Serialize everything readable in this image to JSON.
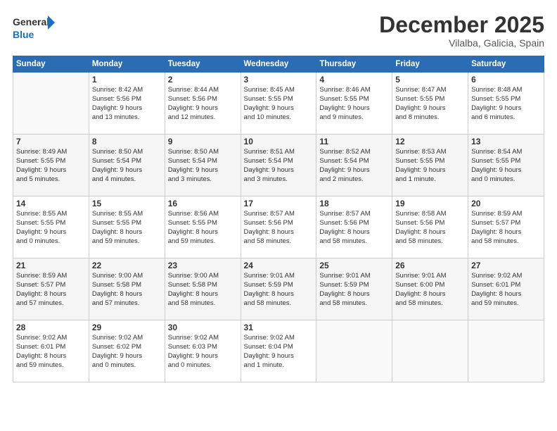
{
  "header": {
    "logo_line1": "General",
    "logo_line2": "Blue",
    "month": "December 2025",
    "location": "Vilalba, Galicia, Spain"
  },
  "weekdays": [
    "Sunday",
    "Monday",
    "Tuesday",
    "Wednesday",
    "Thursday",
    "Friday",
    "Saturday"
  ],
  "weeks": [
    [
      {
        "day": "",
        "info": ""
      },
      {
        "day": "1",
        "info": "Sunrise: 8:42 AM\nSunset: 5:56 PM\nDaylight: 9 hours\nand 13 minutes."
      },
      {
        "day": "2",
        "info": "Sunrise: 8:44 AM\nSunset: 5:56 PM\nDaylight: 9 hours\nand 12 minutes."
      },
      {
        "day": "3",
        "info": "Sunrise: 8:45 AM\nSunset: 5:55 PM\nDaylight: 9 hours\nand 10 minutes."
      },
      {
        "day": "4",
        "info": "Sunrise: 8:46 AM\nSunset: 5:55 PM\nDaylight: 9 hours\nand 9 minutes."
      },
      {
        "day": "5",
        "info": "Sunrise: 8:47 AM\nSunset: 5:55 PM\nDaylight: 9 hours\nand 8 minutes."
      },
      {
        "day": "6",
        "info": "Sunrise: 8:48 AM\nSunset: 5:55 PM\nDaylight: 9 hours\nand 6 minutes."
      }
    ],
    [
      {
        "day": "7",
        "info": "Sunrise: 8:49 AM\nSunset: 5:55 PM\nDaylight: 9 hours\nand 5 minutes."
      },
      {
        "day": "8",
        "info": "Sunrise: 8:50 AM\nSunset: 5:54 PM\nDaylight: 9 hours\nand 4 minutes."
      },
      {
        "day": "9",
        "info": "Sunrise: 8:50 AM\nSunset: 5:54 PM\nDaylight: 9 hours\nand 3 minutes."
      },
      {
        "day": "10",
        "info": "Sunrise: 8:51 AM\nSunset: 5:54 PM\nDaylight: 9 hours\nand 3 minutes."
      },
      {
        "day": "11",
        "info": "Sunrise: 8:52 AM\nSunset: 5:54 PM\nDaylight: 9 hours\nand 2 minutes."
      },
      {
        "day": "12",
        "info": "Sunrise: 8:53 AM\nSunset: 5:55 PM\nDaylight: 9 hours\nand 1 minute."
      },
      {
        "day": "13",
        "info": "Sunrise: 8:54 AM\nSunset: 5:55 PM\nDaylight: 9 hours\nand 0 minutes."
      }
    ],
    [
      {
        "day": "14",
        "info": "Sunrise: 8:55 AM\nSunset: 5:55 PM\nDaylight: 9 hours\nand 0 minutes."
      },
      {
        "day": "15",
        "info": "Sunrise: 8:55 AM\nSunset: 5:55 PM\nDaylight: 8 hours\nand 59 minutes."
      },
      {
        "day": "16",
        "info": "Sunrise: 8:56 AM\nSunset: 5:55 PM\nDaylight: 8 hours\nand 59 minutes."
      },
      {
        "day": "17",
        "info": "Sunrise: 8:57 AM\nSunset: 5:56 PM\nDaylight: 8 hours\nand 58 minutes."
      },
      {
        "day": "18",
        "info": "Sunrise: 8:57 AM\nSunset: 5:56 PM\nDaylight: 8 hours\nand 58 minutes."
      },
      {
        "day": "19",
        "info": "Sunrise: 8:58 AM\nSunset: 5:56 PM\nDaylight: 8 hours\nand 58 minutes."
      },
      {
        "day": "20",
        "info": "Sunrise: 8:59 AM\nSunset: 5:57 PM\nDaylight: 8 hours\nand 58 minutes."
      }
    ],
    [
      {
        "day": "21",
        "info": "Sunrise: 8:59 AM\nSunset: 5:57 PM\nDaylight: 8 hours\nand 57 minutes."
      },
      {
        "day": "22",
        "info": "Sunrise: 9:00 AM\nSunset: 5:58 PM\nDaylight: 8 hours\nand 57 minutes."
      },
      {
        "day": "23",
        "info": "Sunrise: 9:00 AM\nSunset: 5:58 PM\nDaylight: 8 hours\nand 58 minutes."
      },
      {
        "day": "24",
        "info": "Sunrise: 9:01 AM\nSunset: 5:59 PM\nDaylight: 8 hours\nand 58 minutes."
      },
      {
        "day": "25",
        "info": "Sunrise: 9:01 AM\nSunset: 5:59 PM\nDaylight: 8 hours\nand 58 minutes."
      },
      {
        "day": "26",
        "info": "Sunrise: 9:01 AM\nSunset: 6:00 PM\nDaylight: 8 hours\nand 58 minutes."
      },
      {
        "day": "27",
        "info": "Sunrise: 9:02 AM\nSunset: 6:01 PM\nDaylight: 8 hours\nand 59 minutes."
      }
    ],
    [
      {
        "day": "28",
        "info": "Sunrise: 9:02 AM\nSunset: 6:01 PM\nDaylight: 8 hours\nand 59 minutes."
      },
      {
        "day": "29",
        "info": "Sunrise: 9:02 AM\nSunset: 6:02 PM\nDaylight: 9 hours\nand 0 minutes."
      },
      {
        "day": "30",
        "info": "Sunrise: 9:02 AM\nSunset: 6:03 PM\nDaylight: 9 hours\nand 0 minutes."
      },
      {
        "day": "31",
        "info": "Sunrise: 9:02 AM\nSunset: 6:04 PM\nDaylight: 9 hours\nand 1 minute."
      },
      {
        "day": "",
        "info": ""
      },
      {
        "day": "",
        "info": ""
      },
      {
        "day": "",
        "info": ""
      }
    ]
  ]
}
